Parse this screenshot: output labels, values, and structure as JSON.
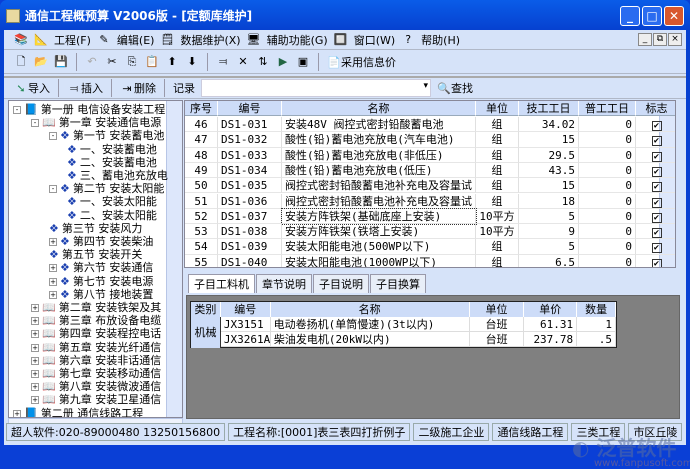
{
  "window": {
    "title": "通信工程概预算  V2006版  - [定额库维护]"
  },
  "menu": [
    "工程(F)",
    "编辑(E)",
    "数据维护(X)",
    "辅助功能(G)",
    "窗口(W)",
    "帮助(H)"
  ],
  "toolbar": {
    "adopt_price": "采用信息价"
  },
  "toolbar2": {
    "import": "导入",
    "insert": "插入",
    "delete": "删除",
    "record": "记录",
    "search_value": "",
    "find": "查找"
  },
  "tree": [
    {
      "level": 0,
      "exp": "-",
      "label": "第一册  电信设备安装工程"
    },
    {
      "level": 1,
      "exp": "-",
      "label": "第一章  安装通信电源"
    },
    {
      "level": 2,
      "exp": "-",
      "label": "第一节  安装蓄电池"
    },
    {
      "level": 3,
      "exp": "",
      "label": "一、安装蓄电池"
    },
    {
      "level": 3,
      "exp": "",
      "label": "二、安装蓄电池"
    },
    {
      "level": 3,
      "exp": "",
      "label": "三、蓄电池充放电"
    },
    {
      "level": 2,
      "exp": "-",
      "label": "第二节  安装太阳能"
    },
    {
      "level": 3,
      "exp": "",
      "label": "一、安装太阳能"
    },
    {
      "level": 3,
      "exp": "",
      "label": "二、安装太阳能"
    },
    {
      "level": 2,
      "exp": "",
      "label": "第三节  安装风力"
    },
    {
      "level": 2,
      "exp": "+",
      "label": "第四节  安装柴油"
    },
    {
      "level": 2,
      "exp": "",
      "label": "第五节  安装开关"
    },
    {
      "level": 2,
      "exp": "+",
      "label": "第六节  安装通信"
    },
    {
      "level": 2,
      "exp": "+",
      "label": "第七节  安装电源"
    },
    {
      "level": 2,
      "exp": "+",
      "label": "第八节  接地装置"
    },
    {
      "level": 1,
      "exp": "+",
      "label": "第二章  安装铁架及其"
    },
    {
      "level": 1,
      "exp": "+",
      "label": "第三章  布放设备电缆"
    },
    {
      "level": 1,
      "exp": "+",
      "label": "第四章  安装程控电话"
    },
    {
      "level": 1,
      "exp": "+",
      "label": "第五章  安装光纤通信"
    },
    {
      "level": 1,
      "exp": "+",
      "label": "第六章  安装非话通信"
    },
    {
      "level": 1,
      "exp": "+",
      "label": "第七章  安装移动通信"
    },
    {
      "level": 1,
      "exp": "+",
      "label": "第八章  安装微波通信"
    },
    {
      "level": 1,
      "exp": "+",
      "label": "第九章  安装卫星通信"
    },
    {
      "level": 0,
      "exp": "+",
      "label": "第二册  通信线路工程"
    }
  ],
  "grid": {
    "columns": [
      "序号",
      "编号",
      "名称",
      "单位",
      "技工工日",
      "普工工日",
      "标志"
    ],
    "rows": [
      [
        "46",
        "DS1-031",
        "安装48V 阀控式密封铅酸蓄电池",
        "组",
        "34.02",
        "0",
        true
      ],
      [
        "47",
        "DS1-032",
        "酸性(铅)蓄电池充放电(汽车电池)",
        "组",
        "15",
        "0",
        true
      ],
      [
        "48",
        "DS1-033",
        "酸性(铅)蓄电池充放电(非低压)",
        "组",
        "29.5",
        "0",
        true
      ],
      [
        "49",
        "DS1-034",
        "酸性(铅)蓄电池充放电(低压)",
        "组",
        "43.5",
        "0",
        true
      ],
      [
        "50",
        "DS1-035",
        "阀控式密封铅酸蓄电池补充电及容量试",
        "组",
        "15",
        "0",
        true
      ],
      [
        "51",
        "DS1-036",
        "阀控式密封铅酸蓄电池补充电及容量试",
        "组",
        "18",
        "0",
        true
      ],
      [
        "52",
        "DS1-037",
        "安装方阵铁架(基础底座上安装)",
        "10平方",
        "5",
        "0",
        true
      ],
      [
        "53",
        "DS1-038",
        "安装方阵铁架(铁塔上安装)",
        "10平方",
        "9",
        "0",
        true
      ],
      [
        "54",
        "DS1-039",
        "安装太阳能电池(500WP以下)",
        "组",
        "5",
        "0",
        true
      ],
      [
        "55",
        "DS1-040",
        "安装太阳能电池(1000WP以下)",
        "组",
        "6.5",
        "0",
        true
      ]
    ]
  },
  "tabs": [
    "子目工料机",
    "章节说明",
    "子目说明",
    "子目换算"
  ],
  "sub": {
    "columns": [
      "类别",
      "编号",
      "名称",
      "单位",
      "单价",
      "数量"
    ],
    "category": "机械",
    "rows": [
      [
        "JX3151",
        "电动卷扬机(单筒慢速)(3t以内)",
        "台班",
        "61.31",
        "1"
      ],
      [
        "JX3261A",
        "柴油发电机(20kW以内)",
        "台班",
        "237.78",
        ".5"
      ]
    ]
  },
  "status": [
    "超人软件:020-89000480 13250156800",
    "工程名称:[0001]表三表四打折例子",
    "二级施工企业",
    "通信线路工程",
    "三类工程",
    "市区丘陵"
  ],
  "watermark": {
    "brand": "泛普软件",
    "url": "www.fanpusoft.com"
  }
}
